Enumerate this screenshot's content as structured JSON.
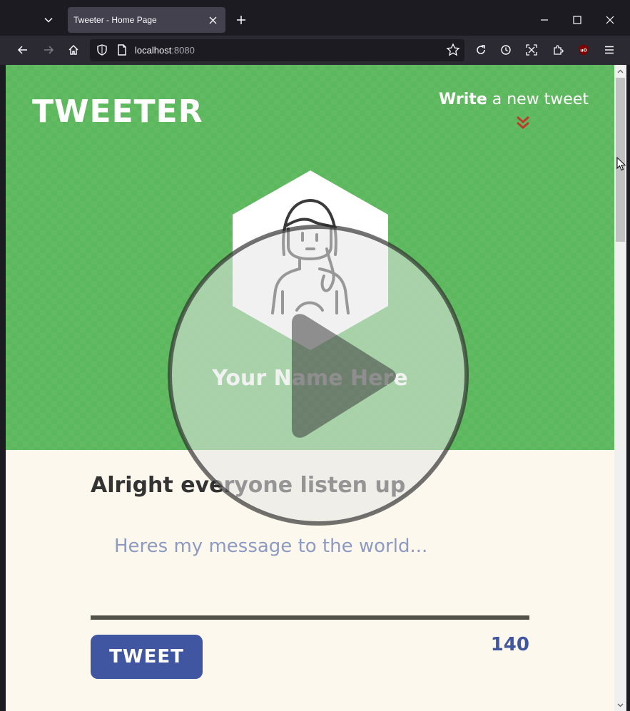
{
  "browser": {
    "tab_title": "Tweeter - Home Page",
    "url_host": "localhost",
    "url_port": ":8080"
  },
  "page": {
    "logo": "TWEETER",
    "write_bold": "Write",
    "write_rest": " a new tweet",
    "user_name": "Your Name Here",
    "tweet_heading": "Alright everyone listen up",
    "tweet_placeholder": "Heres my message to the world...",
    "tweet_button": "TWEET",
    "char_counter": "140"
  },
  "colors": {
    "hero_green": "#5cb85c",
    "accent_blue": "#4156a1",
    "chevron_red": "#c0392b",
    "page_cream": "#fdf8ee"
  },
  "icons": [
    "tab-list-icon",
    "close-icon",
    "plus-icon",
    "minimize-icon",
    "maximize-icon",
    "back-icon",
    "forward-icon",
    "home-icon",
    "shield-icon",
    "page-icon",
    "star-icon",
    "reload-icon",
    "history-icon",
    "screenshot-icon",
    "extensions-icon",
    "ublock-icon",
    "menu-icon",
    "chevron-double-down-icon",
    "avatar-icon",
    "play-icon"
  ]
}
